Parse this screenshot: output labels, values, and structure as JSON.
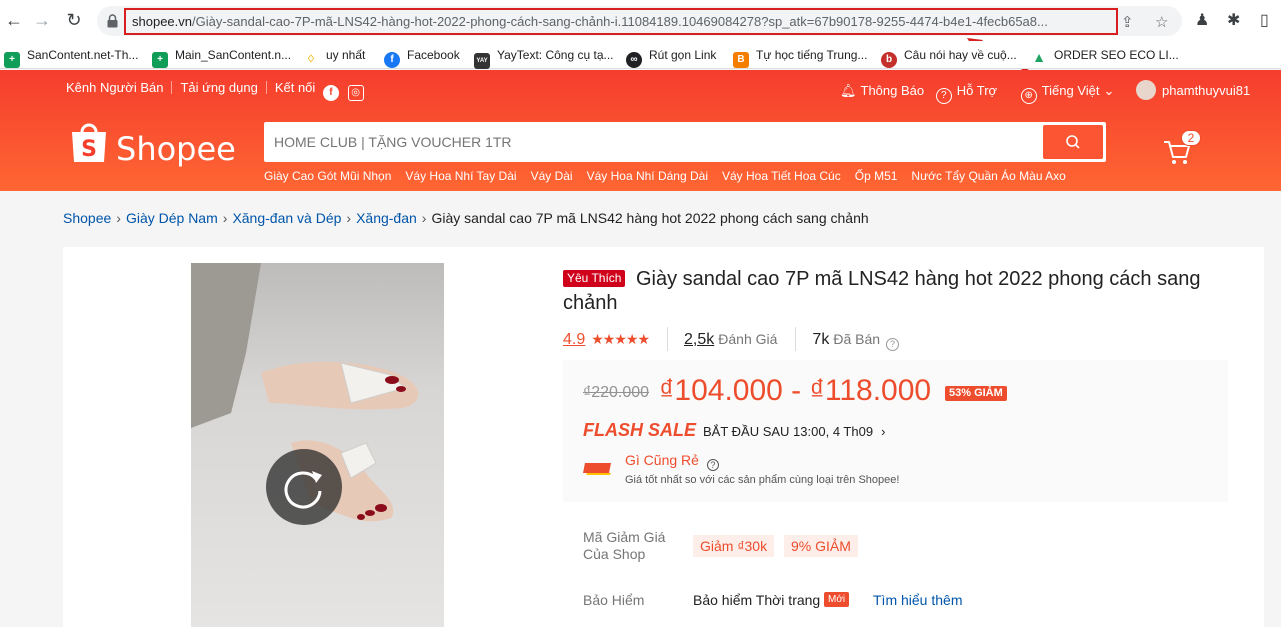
{
  "browser": {
    "url_host": "shopee.vn",
    "url_path": "/Giày-sandal-cao-7P-mã-LNS42-hàng-hot-2022-phong-cách-sang-chảnh-i.11084189.10469084278?sp_atk=67b90178-9255-4474-b4e1-4fecb65a8..."
  },
  "bookmarks": [
    {
      "label": "SanContent.net-Th...",
      "icon": "sheets-icon",
      "color": "#0f9d58"
    },
    {
      "label": "Main_SanContent.n...",
      "icon": "sheets-icon",
      "color": "#0f9d58"
    },
    {
      "label": "uy nhất",
      "icon": "bulb-icon",
      "color": "#f4b400"
    },
    {
      "label": "Facebook",
      "icon": "facebook-icon",
      "color": "#1877f2"
    },
    {
      "label": "YayText: Công cụ tạ...",
      "icon": "yaytext-icon",
      "color": "#333333"
    },
    {
      "label": "Rút gọn Link",
      "icon": "link-icon",
      "color": "#202124"
    },
    {
      "label": "Tự học tiếng Trung...",
      "icon": "blogger-icon",
      "color": "#f57d00"
    },
    {
      "label": "Câu nói hay về cuộ...",
      "icon": "b-icon",
      "color": "#c4302b"
    },
    {
      "label": "ORDER SEO ECO LI...",
      "icon": "drive-icon",
      "color": "#1fa463"
    }
  ],
  "topnav": {
    "seller": "Kênh Người Bán",
    "app": "Tải ứng dụng",
    "connect": "Kết nối",
    "notify": "Thông Báo",
    "support": "Hỗ Trợ",
    "language": "Tiếng Việt",
    "username": "phamthuyvui81"
  },
  "logo": "Shopee",
  "search": {
    "placeholder": "HOME CLUB | TẶNG VOUCHER 1TR"
  },
  "suggestions": [
    "Giày Cao Gót Mũi Nhọn",
    "Váy Hoa Nhí Tay Dài",
    "Váy Dài",
    "Váy Hoa Nhí Dáng Dài",
    "Váy Hoa Tiết Hoa Cúc",
    "Ốp M51",
    "Nước Tẩy Quần Áo Màu Axo"
  ],
  "cart_count": "2",
  "breadcrumb": [
    "Shopee",
    "Giày Dép Nam",
    "Xăng-đan và Dép",
    "Xăng-đan",
    "Giày sandal cao 7P mã LNS42 hàng hot 2022 phong cách sang chảnh"
  ],
  "product": {
    "badge": "Yêu Thích",
    "title": "Giày sandal cao 7P mã LNS42 hàng hot 2022 phong cách sang chảnh",
    "rating": "4.9",
    "reviews": "2,5k",
    "reviews_label": "Đánh Giá",
    "sold": "7k",
    "sold_label": "Đã Bán",
    "old_price": "₫220.000",
    "price_range": "₫104.000 - ₫118.000",
    "discount": "53% GIẢM",
    "flash_sale": "FLASH SALE",
    "flash_start": "BẮT ĐẦU SAU 13:00, 4 Th09",
    "cheap_title": "Gì Cũng Rẻ",
    "cheap_sub": "Giá tốt nhất so với các sản phẩm cùng loại trên Shopee!",
    "voucher_label": "Mã Giảm Giá Của Shop",
    "vouchers": [
      "Giảm ₫30k",
      "9% GIẢM"
    ],
    "insurance_label": "Bảo Hiểm",
    "insurance_text": "Bảo hiểm Thời trang",
    "new_tag": "Mới",
    "learn_more": "Tìm hiểu thêm"
  },
  "colors": {
    "brand": "#ee4d2d",
    "highlight_box": "#d71f20"
  }
}
